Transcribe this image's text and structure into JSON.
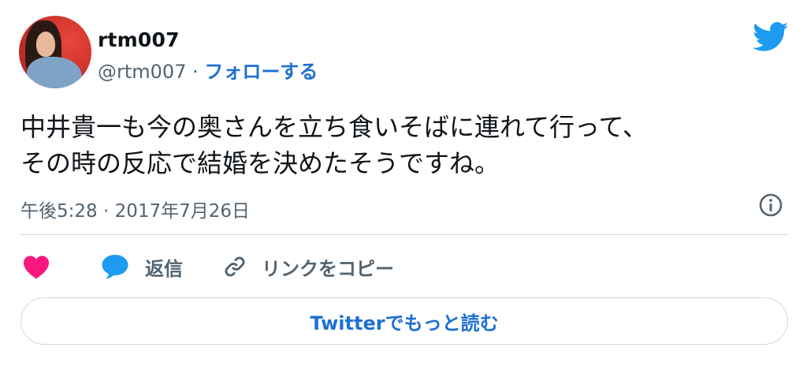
{
  "user": {
    "display_name": "rtm007",
    "handle": "@rtm007",
    "separator": " · ",
    "follow_label": "フォローする"
  },
  "tweet": {
    "lines": [
      "中井貴一も今の奥さんを立ち食いそばに連れて行って、",
      "その時の反応で結婚を決めたそうですね。"
    ],
    "timestamp": "午後5:28 · 2017年7月26日"
  },
  "actions": {
    "reply_label": "返信",
    "copy_link_label": "リンクをコピー"
  },
  "read_more_label": "Twitterでもっと読む",
  "icons": {
    "brand": "twitter-bird-icon",
    "info": "info-icon",
    "like": "heart-icon",
    "reply": "speech-bubble-icon",
    "copy": "link-icon"
  },
  "colors": {
    "twitter_blue": "#1d9bf0",
    "link_blue": "#1d70d3",
    "heart_pink": "#f91880",
    "muted_text": "#536471",
    "border": "#cfd9de"
  }
}
